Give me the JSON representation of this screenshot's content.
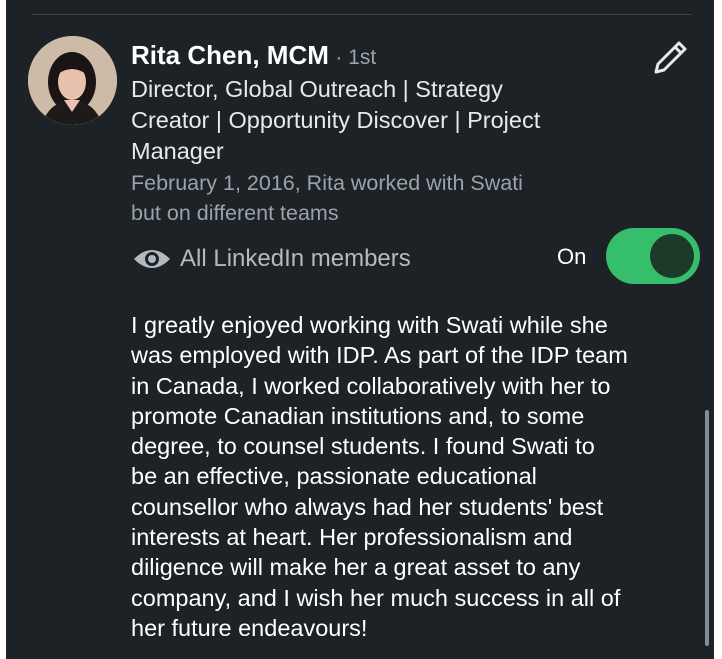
{
  "recommender": {
    "name": "Rita Chen, MCM",
    "degree": "· 1st",
    "headline": [
      "Director, Global Outreach | Strategy",
      "Creator | Opportunity Discover | Project",
      "Manager"
    ],
    "relation": [
      "February 1, 2016, Rita worked with Swati",
      "but on different teams"
    ]
  },
  "visibility": {
    "label": "All LinkedIn members",
    "toggle_label": "On",
    "enabled": true
  },
  "recommendation_lines": [
    "I greatly enjoyed working with Swati while she",
    "was employed with IDP.  As part of the IDP team",
    "in Canada, I worked collaboratively with her to",
    "promote Canadian institutions and, to some",
    "degree, to counsel students.  I found Swati to",
    "be an effective, passionate educational",
    "counsellor who always had her students' best",
    "interests at heart.  Her professionalism and",
    "diligence will make her a great asset to any",
    "company, and I wish her much success in all of",
    "her future endeavours!"
  ],
  "icons": {
    "edit": "pencil-icon",
    "visibility": "eye-icon"
  },
  "colors": {
    "background": "#1d2226",
    "toggle_on": "#35bf6d",
    "muted_text": "#9aa3a9"
  }
}
